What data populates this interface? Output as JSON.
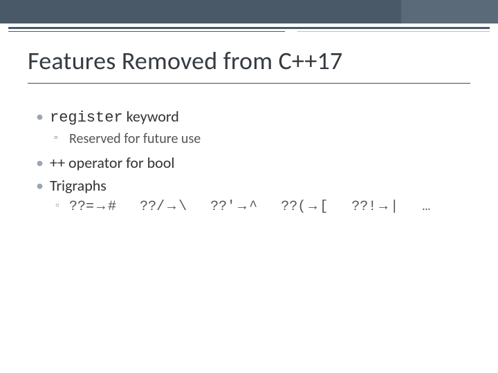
{
  "title": "Features Removed from C++17",
  "bullets": {
    "b1_code": "register",
    "b1_rest": " keyword",
    "b1_sub": "Reserved for future use",
    "b2": "++ operator for bool",
    "b3": "Trigraphs",
    "trigraphs": [
      {
        "src": "??=",
        "dst": "#"
      },
      {
        "src": "??/",
        "dst": "\\"
      },
      {
        "src": "??'",
        "dst": "^"
      },
      {
        "src": "??(",
        "dst": "["
      },
      {
        "src": "??!",
        "dst": "|"
      }
    ],
    "ellipsis": "…",
    "arrow": "→"
  }
}
